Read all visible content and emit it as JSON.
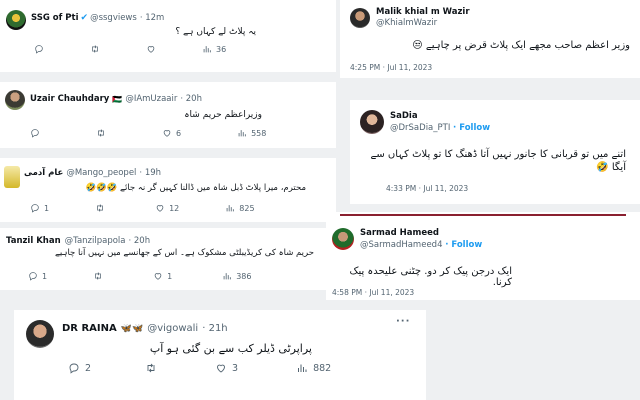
{
  "tweets_left": [
    {
      "name": "SSG of Pti",
      "handle": "@ssgviews",
      "time": "· 12m",
      "text": "یہ پلاٹ لے کہاں ہے ؟",
      "reply": "",
      "retweet": "",
      "like": "",
      "views": "36"
    },
    {
      "name": "Uzair Chauhdary",
      "flag": "🇵🇸",
      "handle": "@IAmUzaair",
      "time": "· 20h",
      "text": "وزیراعظم حریم شاہ",
      "reply": "",
      "retweet": "",
      "like": "6",
      "views": "558"
    },
    {
      "name": "عام آدمی",
      "handle": "@Mango_peopel",
      "time": "· 19h",
      "text": "محترم، میرا پلاٹ ڈبل شاہ میں ڈالنا کہیں گر نہ جائے 🤣🤣🤣",
      "reply": "1",
      "retweet": "",
      "like": "12",
      "views": "825"
    },
    {
      "name": "Tanzil Khan",
      "handle": "@Tanzilpapola",
      "time": "· 20h",
      "text": "حریم شاہ کی کریڈیبلٹی مشکوک ہے۔ اس کے جھانسے میں نہیں آنا چاہیے",
      "reply": "1",
      "retweet": "",
      "like": "1",
      "views": "386"
    },
    {
      "name": "DR RAINA",
      "emoji": "🦋🦋",
      "handle": "@vigowali",
      "time": "· 21h",
      "text": "پراپرٹی ڈیلر کب سے بن گئی ہو آپ",
      "reply": "2",
      "retweet": "",
      "like": "3",
      "views": "882"
    }
  ],
  "tweets_right": [
    {
      "name": "Malik khial m Wazir",
      "handle": "@KhialmWazir",
      "follow": "",
      "text": "وزیر اعظم صاحب مجھے ایک پلاٹ قرض پر چاہیے 😒",
      "timestamp": "4:25 PM · Jul 11, 2023"
    },
    {
      "name": "SaDia",
      "handle": "@DrSaDia_PTI",
      "follow": "· Follow",
      "text": "اتنے میں تو قربانی کا جانور نہیں آتا ڈھنگ کا تو پلاٹ کہاں سے آیگا 🤣",
      "timestamp": "4:33 PM · Jul 11, 2023"
    },
    {
      "name": "Sarmad Hameed",
      "handle": "@SarmadHameed4",
      "follow": "· Follow",
      "text": "ایک درجن پیک کر دو. چٹنی علیحدہ پیک کرنا.",
      "timestamp": "4:58 PM · Jul 11, 2023"
    }
  ],
  "icons": [
    "reply-icon",
    "retweet-icon",
    "like-icon",
    "views-icon",
    "more-icon"
  ],
  "colors": {
    "link": "#1d9bf0",
    "muted": "#536471",
    "text": "#0f1419",
    "divider": "#8a2030"
  }
}
